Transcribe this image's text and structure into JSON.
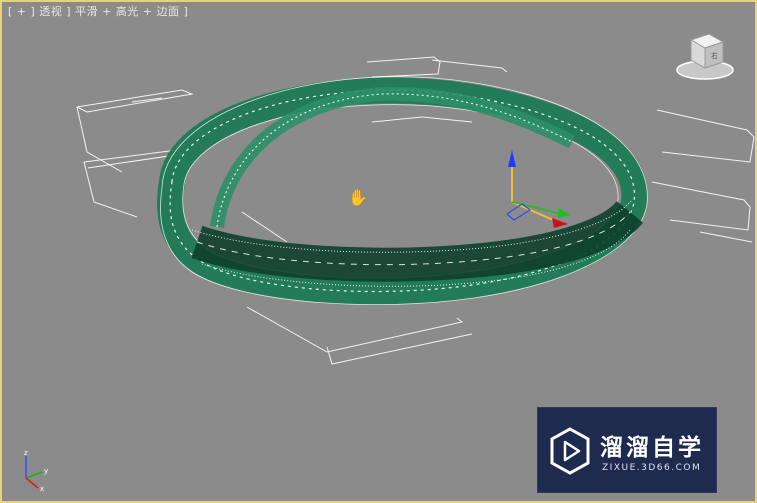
{
  "viewport": {
    "label": "[ + ] 透视 ] 平滑 + 高光 + 边面 ]",
    "colors": {
      "background": "#8b8b8b",
      "active_border": "#e8d27a",
      "mesh_fill": "#1d7a57",
      "mesh_wire": "#ffffff",
      "helper_lines": "#ffffff"
    }
  },
  "viewcube": {
    "icon": "viewcube-icon",
    "face_label": "右"
  },
  "gizmo": {
    "icon": "move-gizmo-icon"
  },
  "cursor": {
    "icon": "hand-pan-icon",
    "glyph": "✋"
  },
  "axis_tripod": {
    "icon": "world-axis-icon",
    "z": "z",
    "y": "y",
    "x": "x"
  },
  "watermark": {
    "title": "溜溜自学",
    "url": "ZIXUE.3D66.COM",
    "icon": "play-logo-icon"
  }
}
